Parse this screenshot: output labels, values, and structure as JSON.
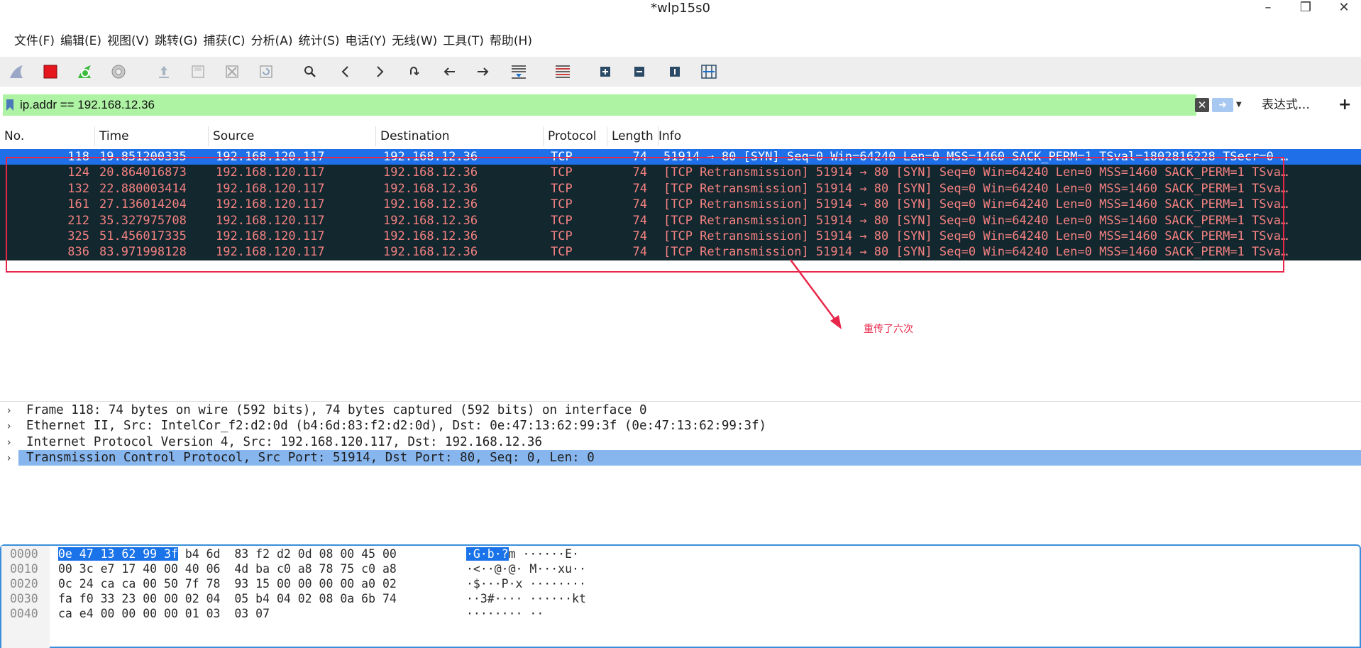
{
  "window": {
    "title": "*wlp15s0",
    "minimize": "–",
    "maximize": "❐",
    "close": "✕"
  },
  "menu": [
    "文件(F)",
    "编辑(E)",
    "视图(V)",
    "跳转(G)",
    "捕获(C)",
    "分析(A)",
    "统计(S)",
    "电话(Y)",
    "无线(W)",
    "工具(T)",
    "帮助(H)"
  ],
  "toolbar": {
    "icons": [
      "shark-fin-start-icon",
      "stop-capture-icon",
      "restart-capture-icon",
      "capture-options-icon",
      "open-file-icon",
      "save-file-icon",
      "close-file-icon",
      "reload-icon",
      "find-icon",
      "back-icon",
      "forward-icon",
      "go-to-packet-icon",
      "first-packet-icon",
      "last-packet-icon",
      "autoscroll-icon",
      "colorize-icon",
      "zoom-in-icon",
      "zoom-out-icon",
      "normal-size-icon",
      "resize-columns-icon"
    ]
  },
  "filter": {
    "value": "ip.addr == 192.168.12.36",
    "expression_label": "表达式…",
    "add_label": "+"
  },
  "columns": [
    "No.",
    "Time",
    "Source",
    "Destination",
    "Protocol",
    "Length",
    "Info"
  ],
  "packets": [
    {
      "no": "118",
      "time": "19.851200335",
      "src": "192.168.120.117",
      "dst": "192.168.12.36",
      "proto": "TCP",
      "len": "74",
      "info": "51914 → 80 [SYN] Seq=0 Win=64240 Len=0 MSS=1460 SACK_PERM=1 TSval=1802816228 TSecr=0 …",
      "selected": true
    },
    {
      "no": "124",
      "time": "20.864016873",
      "src": "192.168.120.117",
      "dst": "192.168.12.36",
      "proto": "TCP",
      "len": "74",
      "info": "[TCP Retransmission] 51914 → 80 [SYN] Seq=0 Win=64240 Len=0 MSS=1460 SACK_PERM=1 TSva…"
    },
    {
      "no": "132",
      "time": "22.880003414",
      "src": "192.168.120.117",
      "dst": "192.168.12.36",
      "proto": "TCP",
      "len": "74",
      "info": "[TCP Retransmission] 51914 → 80 [SYN] Seq=0 Win=64240 Len=0 MSS=1460 SACK_PERM=1 TSva…"
    },
    {
      "no": "161",
      "time": "27.136014204",
      "src": "192.168.120.117",
      "dst": "192.168.12.36",
      "proto": "TCP",
      "len": "74",
      "info": "[TCP Retransmission] 51914 → 80 [SYN] Seq=0 Win=64240 Len=0 MSS=1460 SACK_PERM=1 TSva…"
    },
    {
      "no": "212",
      "time": "35.327975708",
      "src": "192.168.120.117",
      "dst": "192.168.12.36",
      "proto": "TCP",
      "len": "74",
      "info": "[TCP Retransmission] 51914 → 80 [SYN] Seq=0 Win=64240 Len=0 MSS=1460 SACK_PERM=1 TSva…"
    },
    {
      "no": "325",
      "time": "51.456017335",
      "src": "192.168.120.117",
      "dst": "192.168.12.36",
      "proto": "TCP",
      "len": "74",
      "info": "[TCP Retransmission] 51914 → 80 [SYN] Seq=0 Win=64240 Len=0 MSS=1460 SACK_PERM=1 TSva…"
    },
    {
      "no": "836",
      "time": "83.971998128",
      "src": "192.168.120.117",
      "dst": "192.168.12.36",
      "proto": "TCP",
      "len": "74",
      "info": "[TCP Retransmission] 51914 → 80 [SYN] Seq=0 Win=64240 Len=0 MSS=1460 SACK_PERM=1 TSva…"
    }
  ],
  "annotation": {
    "text": "重传了六次",
    "color": "#e8264a"
  },
  "details": [
    {
      "text": "Frame 118: 74 bytes on wire (592 bits), 74 bytes captured (592 bits) on interface 0"
    },
    {
      "text": "Ethernet II, Src: IntelCor_f2:d2:0d (b4:6d:83:f2:d2:0d), Dst: 0e:47:13:62:99:3f (0e:47:13:62:99:3f)"
    },
    {
      "text": "Internet Protocol Version 4, Src: 192.168.120.117, Dst: 192.168.12.36"
    },
    {
      "text": "Transmission Control Protocol, Src Port: 51914, Dst Port: 80, Seq: 0, Len: 0",
      "selected": true
    }
  ],
  "bytes": [
    {
      "offset": "0000",
      "hex_hl": "0e 47 13 62 99 3f",
      "hex": " b4 6d  83 f2 d2 0d 08 00 45 00",
      "ascii_hl": "·G·b·?",
      "ascii": "m ······E·"
    },
    {
      "offset": "0010",
      "hex_hl": "",
      "hex": "00 3c e7 17 40 00 40 06  4d ba c0 a8 78 75 c0 a8",
      "ascii_hl": "",
      "ascii": "·<··@·@· M···xu··"
    },
    {
      "offset": "0020",
      "hex_hl": "",
      "hex": "0c 24 ca ca 00 50 7f 78  93 15 00 00 00 00 a0 02",
      "ascii_hl": "",
      "ascii": "·$···P·x ········"
    },
    {
      "offset": "0030",
      "hex_hl": "",
      "hex": "fa f0 33 23 00 00 02 04  05 b4 04 02 08 0a 6b 74",
      "ascii_hl": "",
      "ascii": "··3#···· ······kt"
    },
    {
      "offset": "0040",
      "hex_hl": "",
      "hex": "ca e4 00 00 00 00 01 03  03 07",
      "ascii_hl": "",
      "ascii": "········ ··"
    }
  ],
  "colors": {
    "filter_ok": "#aef3a4",
    "row_bg": "#12272e",
    "row_fg": "#f48181",
    "selected_row": "#1e6fe8",
    "detail_selected": "#87b6ee",
    "byte_highlight": "#1a73e8"
  }
}
